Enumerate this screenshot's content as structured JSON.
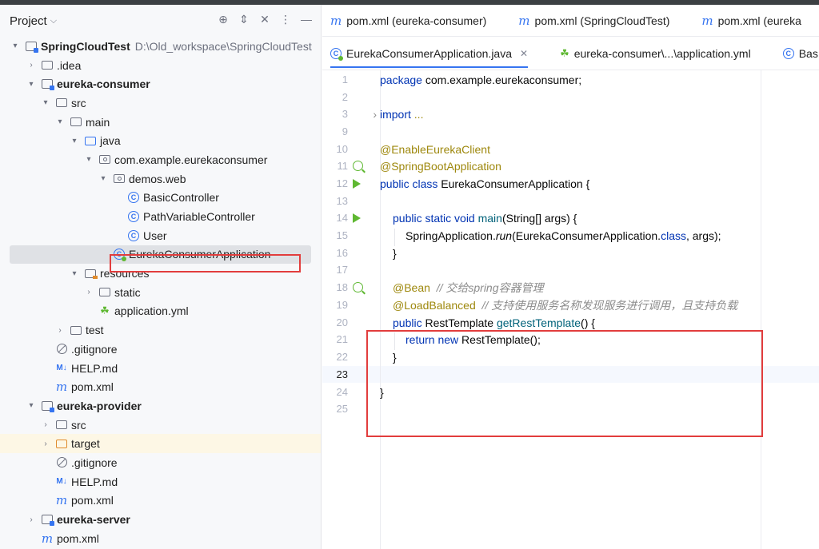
{
  "project_panel": {
    "title": "Project",
    "tree": [
      {
        "label": "SpringCloudTest",
        "path": "D:\\Old_workspace\\SpringCloudTest"
      },
      {
        "label": ".idea"
      },
      {
        "label": "eureka-consumer"
      },
      {
        "label": "src"
      },
      {
        "label": "main"
      },
      {
        "label": "java"
      },
      {
        "label": "com.example.eurekaconsumer"
      },
      {
        "label": "demos.web"
      },
      {
        "label": "BasicController"
      },
      {
        "label": "PathVariableController"
      },
      {
        "label": "User"
      },
      {
        "label": "EurekaConsumerApplication"
      },
      {
        "label": "resources"
      },
      {
        "label": "static"
      },
      {
        "label": "application.yml"
      },
      {
        "label": "test"
      },
      {
        "label": ".gitignore"
      },
      {
        "label": "HELP.md"
      },
      {
        "label": "pom.xml"
      },
      {
        "label": "eureka-provider"
      },
      {
        "label": "src"
      },
      {
        "label": "target"
      },
      {
        "label": ".gitignore"
      },
      {
        "label": "HELP.md"
      },
      {
        "label": "pom.xml"
      },
      {
        "label": "eureka-server"
      },
      {
        "label": "pom.xml"
      }
    ]
  },
  "editor": {
    "tabs_row1": [
      "pom.xml (eureka-consumer)",
      "pom.xml (SpringCloudTest)",
      "pom.xml (eureka"
    ],
    "tabs_row2": [
      "EurekaConsumerApplication.java",
      "eureka-consumer\\...\\application.yml",
      "Bas"
    ],
    "line_numbers": [
      "1",
      "2",
      "3",
      "9",
      "10",
      "11",
      "12",
      "13",
      "14",
      "15",
      "16",
      "17",
      "18",
      "19",
      "20",
      "21",
      "22",
      "23",
      "24",
      "25"
    ],
    "code": {
      "l1_kw": "package",
      "l1_rest": " com.example.eurekaconsumer;",
      "l3_kw": "import",
      "l3_rest": " ...",
      "l10": "@EnableEurekaClient",
      "l11": "@SpringBootApplication",
      "l12_kw": "public class",
      "l12_rest": " EurekaConsumerApplication {",
      "l14_kw": "public static void",
      "l14_fn": "main",
      "l14_rest": "(String[] args) {",
      "l15_a": "SpringApplication.",
      "l15_b": "run",
      "l15_c": "(EurekaConsumerApplication.",
      "l15_kw": "class",
      "l15_d": ", args);",
      "l16": "}",
      "l18_ann": "@Bean",
      "l18_cmt": "// 交给spring容器管理",
      "l19_ann": "@LoadBalanced",
      "l19_cmt": "// 支持使用服务名称发现服务进行调用，且支持负载",
      "l20_kw": "public",
      "l20_a": " RestTemplate ",
      "l20_fn": "getRestTemplate",
      "l20_b": "() {",
      "l21_kw": "return new",
      "l21_rest": " RestTemplate();",
      "l22": "}",
      "l24": "}"
    }
  },
  "colors": {
    "keyword": "#0033b3",
    "annotation": "#9e880d",
    "method": "#00627a",
    "comment": "#8c8c8c",
    "highlight_box": "#e23d3d",
    "accent": "#3574f0"
  }
}
